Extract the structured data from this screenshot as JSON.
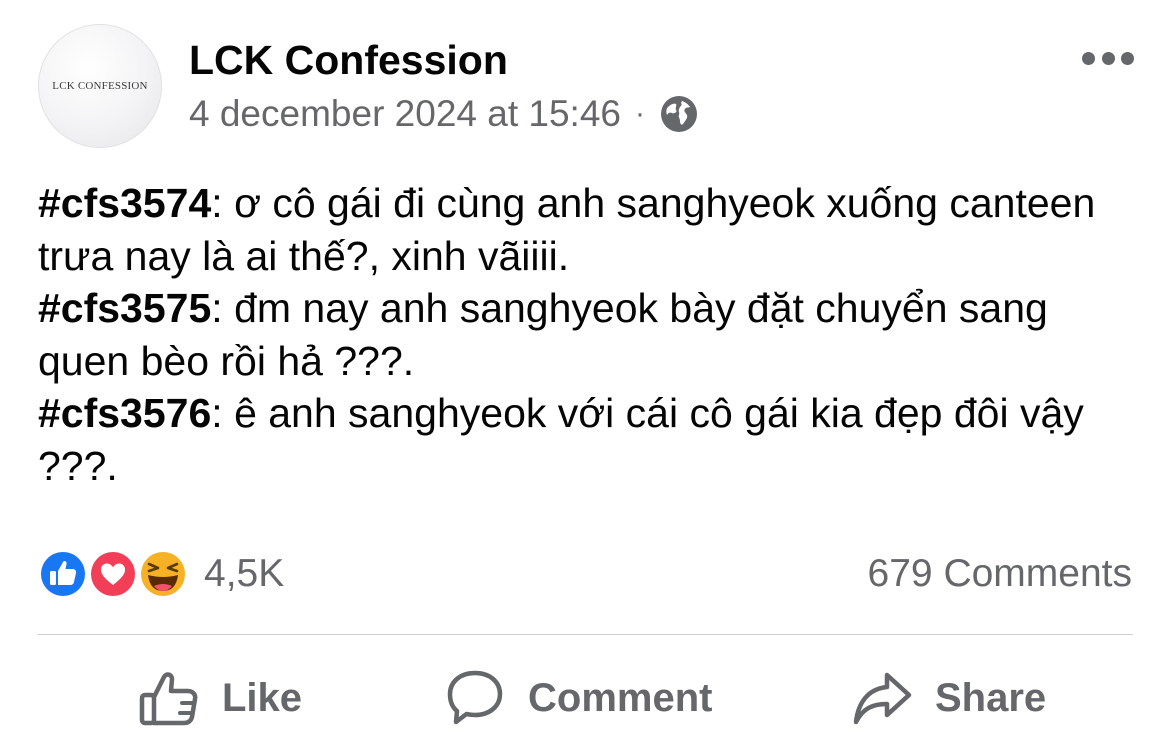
{
  "header": {
    "avatar_text": "LCK CONFESSION",
    "page_name": "LCK Confession",
    "timestamp": "4 december 2024 at 15:46",
    "separator": "·",
    "audience_icon": "globe-icon",
    "more_icon": "more-horizontal-icon"
  },
  "post": {
    "confessions": [
      {
        "tag": "#cfs3574",
        "text": ": ơ cô gái đi cùng anh sanghyeok xuống canteen trưa nay là ai thế?, xinh vãiiii."
      },
      {
        "tag": "#cfs3575",
        "text": ": đm nay anh sanghyeok bày đặt chuyển sang quen bèo rồi hả ???."
      },
      {
        "tag": "#cfs3576",
        "text": ": ê anh sanghyeok với cái cô gái kia đẹp đôi vậy ???."
      }
    ]
  },
  "stats": {
    "reaction_icons": [
      "like-reaction-icon",
      "love-reaction-icon",
      "haha-reaction-icon"
    ],
    "reaction_count": "4,5K",
    "comments": "679 Comments"
  },
  "actions": {
    "like": {
      "label": "Like",
      "icon": "thumbs-up-icon"
    },
    "comment": {
      "label": "Comment",
      "icon": "speech-bubble-icon"
    },
    "share": {
      "label": "Share",
      "icon": "share-arrow-icon"
    }
  },
  "colors": {
    "primary_text": "#050505",
    "secondary_text": "#65676b",
    "like_blue": "#1877f2",
    "love_red": "#f33e58",
    "haha_yellow": "#f7b125",
    "divider": "#ced0d4"
  }
}
